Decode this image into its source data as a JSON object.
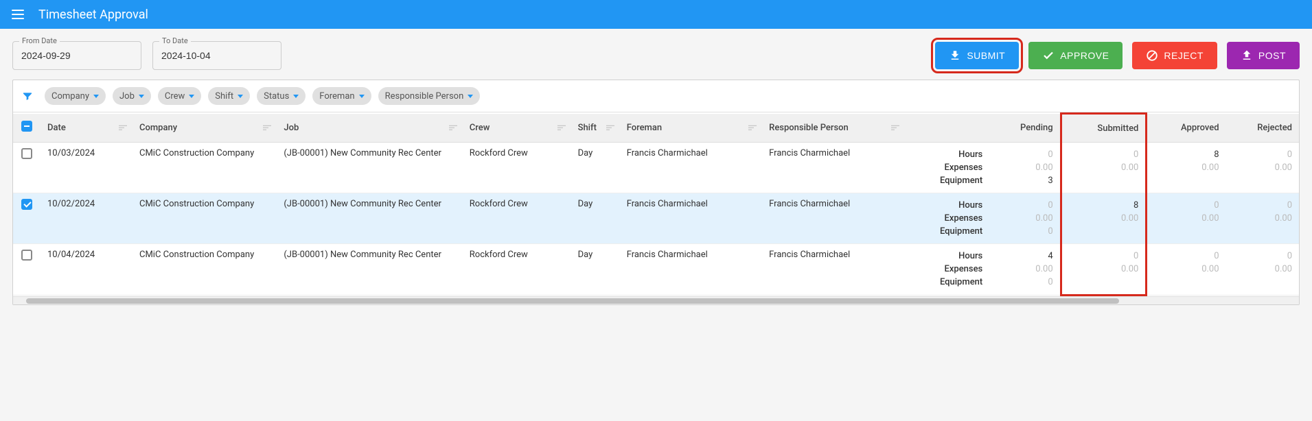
{
  "header": {
    "title": "Timesheet Approval"
  },
  "filters": {
    "from_label": "From Date",
    "from_value": "2024-09-29",
    "to_label": "To Date",
    "to_value": "2024-10-04"
  },
  "actions": {
    "submit": "SUBMIT",
    "approve": "APPROVE",
    "reject": "REJECT",
    "post": "POST"
  },
  "chips": [
    "Company",
    "Job",
    "Crew",
    "Shift",
    "Status",
    "Foreman",
    "Responsible Person"
  ],
  "columns": {
    "date": "Date",
    "company": "Company",
    "job": "Job",
    "crew": "Crew",
    "shift": "Shift",
    "foreman": "Foreman",
    "responsible": "Responsible Person",
    "pending": "Pending",
    "submitted": "Submitted",
    "approved": "Approved",
    "rejected": "Rejected"
  },
  "metric_labels": {
    "hours": "Hours",
    "expenses": "Expenses",
    "equipment": "Equipment"
  },
  "rows": [
    {
      "checked": false,
      "date": "10/03/2024",
      "company": "CMiC Construction Company",
      "job": "(JB-00001) New Community Rec Center",
      "crew": "Rockford Crew",
      "shift": "Day",
      "foreman": "Francis Charmichael",
      "responsible": "Francis Charmichael",
      "pending": {
        "hours": "0",
        "expenses": "0.00",
        "equipment": "3"
      },
      "submitted": {
        "hours": "0",
        "expenses": "0.00",
        "equipment": ""
      },
      "approved": {
        "hours": "8",
        "expenses": "0.00",
        "equipment": ""
      },
      "rejected": {
        "hours": "0",
        "expenses": "0.00",
        "equipment": ""
      }
    },
    {
      "checked": true,
      "date": "10/02/2024",
      "company": "CMiC Construction Company",
      "job": "(JB-00001) New Community Rec Center",
      "crew": "Rockford Crew",
      "shift": "Day",
      "foreman": "Francis Charmichael",
      "responsible": "Francis Charmichael",
      "pending": {
        "hours": "0",
        "expenses": "0.00",
        "equipment": "0"
      },
      "submitted": {
        "hours": "8",
        "expenses": "0.00",
        "equipment": ""
      },
      "approved": {
        "hours": "0",
        "expenses": "0.00",
        "equipment": ""
      },
      "rejected": {
        "hours": "0",
        "expenses": "0.00",
        "equipment": ""
      }
    },
    {
      "checked": false,
      "date": "10/04/2024",
      "company": "CMiC Construction Company",
      "job": "(JB-00001) New Community Rec Center",
      "crew": "Rockford Crew",
      "shift": "Day",
      "foreman": "Francis Charmichael",
      "responsible": "Francis Charmichael",
      "pending": {
        "hours": "4",
        "expenses": "0.00",
        "equipment": "0"
      },
      "submitted": {
        "hours": "0",
        "expenses": "0.00",
        "equipment": ""
      },
      "approved": {
        "hours": "0",
        "expenses": "0.00",
        "equipment": ""
      },
      "rejected": {
        "hours": "0",
        "expenses": "0.00",
        "equipment": ""
      }
    }
  ]
}
